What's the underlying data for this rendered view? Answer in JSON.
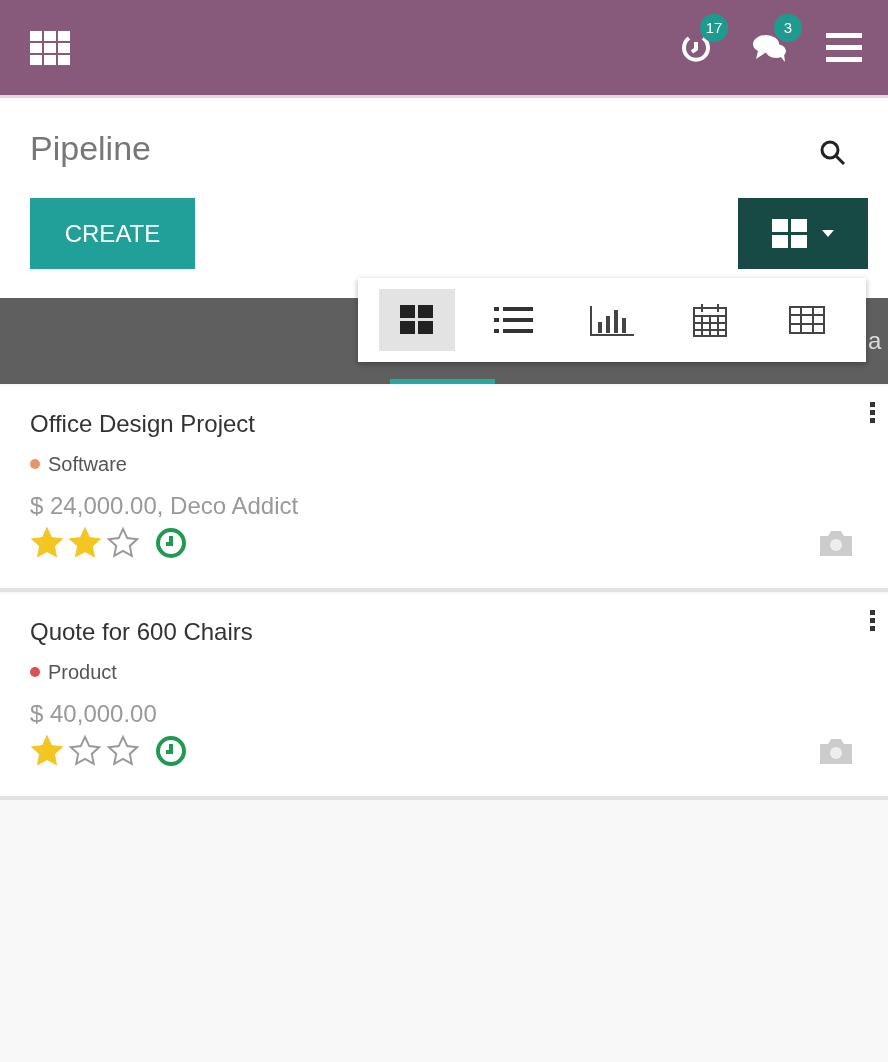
{
  "navbar": {
    "badges": [
      {
        "kind": "activity",
        "count": "17"
      },
      {
        "kind": "messages",
        "count": "3"
      }
    ]
  },
  "control_panel": {
    "title": "Pipeline",
    "create_button": "CREATE"
  },
  "views": [
    {
      "kind": "kanban",
      "selected": true
    },
    {
      "kind": "list",
      "selected": false
    },
    {
      "kind": "graph",
      "selected": false
    },
    {
      "kind": "calendar",
      "selected": false
    },
    {
      "kind": "pivot",
      "selected": false
    }
  ],
  "stage_bar": {
    "next_stage_label": "a"
  },
  "cards": [
    {
      "title": "Office Design Project",
      "tag": "Software",
      "color": "#e8956a",
      "amount": "$ 24,000.00, Deco Addict",
      "stars": 2
    },
    {
      "title": "Quote for 600 Chairs",
      "tag": "Product",
      "color": "#d9534f",
      "amount": "$ 40,000.00",
      "stars": 1
    }
  ]
}
